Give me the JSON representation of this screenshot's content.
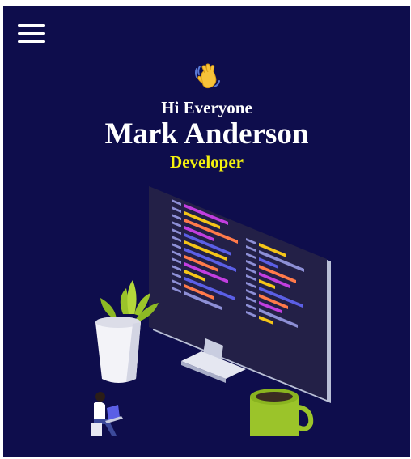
{
  "header": {
    "menu_icon": "hamburger-menu-icon"
  },
  "hero": {
    "wave_icon": "waving-hand-icon",
    "greeting": "Hi Everyone",
    "name": "Mark Anderson",
    "role": "Developer"
  },
  "illustration": {
    "name": "developer-desk-illustration"
  },
  "colors": {
    "background": "#0e0d4c",
    "heading": "#ffffff",
    "role_accent": "#f5f20e"
  }
}
